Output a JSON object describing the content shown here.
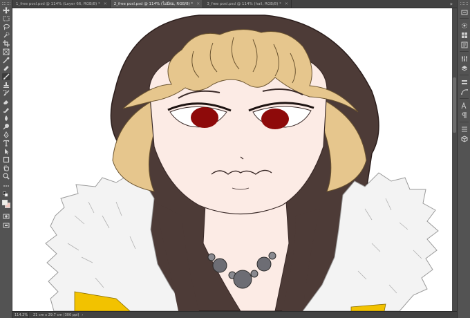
{
  "tabs": [
    {
      "label": "1_free posl.psd @ 114% (Layer 66, RGB/8) *",
      "active": false
    },
    {
      "label": "2_free posl.psd @ 114% (ไม่มีผม, RGB/8) *",
      "active": true
    },
    {
      "label": "3_free posl.psd @ 114% (hail, RGB/8) *",
      "active": false
    }
  ],
  "tab_close_glyph": "×",
  "tabs_overflow_glyph": "»",
  "tools": [
    "move-tool",
    "marquee-tool",
    "lasso-tool",
    "quick-select-tool",
    "crop-tool",
    "frame-tool",
    "eyedropper-tool",
    "healing-brush-tool",
    "brush-tool",
    "clone-stamp-tool",
    "history-brush-tool",
    "eraser-tool",
    "gradient-tool",
    "blur-tool",
    "dodge-tool",
    "pen-tool",
    "type-tool",
    "path-select-tool",
    "shape-tool",
    "hand-tool",
    "zoom-tool",
    "more-tools"
  ],
  "active_tool": "brush-tool",
  "colors": {
    "foreground": "#efefe8",
    "background": "#f5c9bf",
    "hair_dark": "#4d3b37",
    "hair_blonde": "#e6c68d",
    "skin": "#fcebe5",
    "eyes": "#8e0a0a",
    "fur": "#f3f3f3",
    "coat": "#f2c200"
  },
  "dock_panels": [
    "history-icon",
    "color-icon",
    "swatches-icon",
    "libraries-icon",
    "adjustments-icon",
    "layers-icon",
    "channels-icon",
    "paths-icon",
    "character-icon",
    "paragraph-icon",
    "properties-icon",
    "3d-icon"
  ],
  "status": {
    "zoom": "114.2%",
    "doc_info": "21 cm x 29.7 cm (300 ppi)",
    "arrow": "›"
  }
}
